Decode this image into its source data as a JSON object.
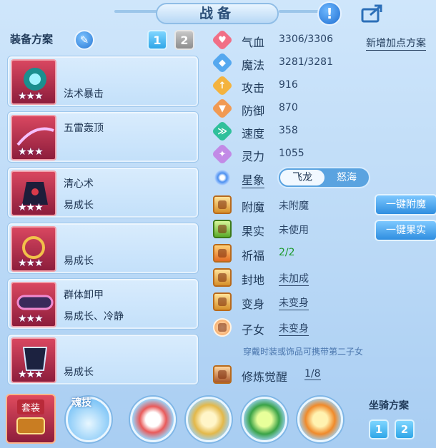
{
  "header": {
    "title": "战备"
  },
  "left": {
    "plan_title": "装备方案",
    "plan_buttons": [
      "1",
      "2"
    ],
    "equipment": [
      {
        "line1": "",
        "line2": "法术暴击",
        "stars": "★★★"
      },
      {
        "line1": "五雷轰顶",
        "line2": "",
        "stars": "★★★"
      },
      {
        "line1": "清心术",
        "line2": "易成长",
        "stars": "★★★"
      },
      {
        "line1": "",
        "line2": "易成长",
        "stars": "★★★"
      },
      {
        "line1": "群体卸甲",
        "line2": "易成长、冷静",
        "stars": "★★★"
      },
      {
        "line1": "",
        "line2": "易成长",
        "stars": "★★★"
      }
    ]
  },
  "stats": {
    "add_points": "新增加点方案",
    "rows": [
      {
        "label": "气血",
        "value": "3306/3306",
        "color": "#f16f86",
        "glyph": "♥"
      },
      {
        "label": "魔法",
        "value": "3281/3281",
        "color": "#55a8ef",
        "glyph": "◆"
      },
      {
        "label": "攻击",
        "value": "916",
        "color": "#f4b33e",
        "glyph": "↑"
      },
      {
        "label": "防御",
        "value": "870",
        "color": "#f19a53",
        "glyph": "▼"
      },
      {
        "label": "速度",
        "value": "358",
        "color": "#2fc09b",
        "glyph": "≫"
      },
      {
        "label": "灵力",
        "value": "1055",
        "color": "#c28ae6",
        "glyph": "✦"
      }
    ],
    "xingxiang": {
      "label": "星象",
      "options": [
        "飞龙",
        "怒海"
      ],
      "selected": "飞龙"
    }
  },
  "extras": {
    "rows": [
      {
        "label": "附魔",
        "value": "未附魔",
        "style": "plain",
        "button": "一键附魔"
      },
      {
        "label": "果实",
        "value": "未使用",
        "style": "plain",
        "button": "一键果实"
      },
      {
        "label": "祈福",
        "value": "2/2",
        "style": "green",
        "button": ""
      },
      {
        "label": "封地",
        "value": "未加成",
        "style": "link",
        "button": ""
      },
      {
        "label": "变身",
        "value": "未变身",
        "style": "link",
        "button": ""
      },
      {
        "label": "子女",
        "value": "未变身",
        "style": "link",
        "button": ""
      }
    ],
    "hint": "穿戴时装或饰品可携带第二子女",
    "cultivation": {
      "label": "修炼觉醒",
      "value": "1/8"
    }
  },
  "bottom": {
    "suit_label": "套装",
    "soul_label": "魂技",
    "mount_title": "坐骑方案",
    "mount_buttons": [
      "1",
      "2"
    ]
  },
  "colors": {
    "accent": "#2ea6e8",
    "panel": "#c3e0fa",
    "green_text": "#1c9a2c"
  },
  "icons": {
    "top": [
      "help-icon",
      "share-icon"
    ],
    "edit": "pencil-icon",
    "skills": [
      "red-fan-skill-icon",
      "golden-swords-skill-icon",
      "green-flame-skill-icon",
      "fire-burst-skill-icon"
    ]
  }
}
